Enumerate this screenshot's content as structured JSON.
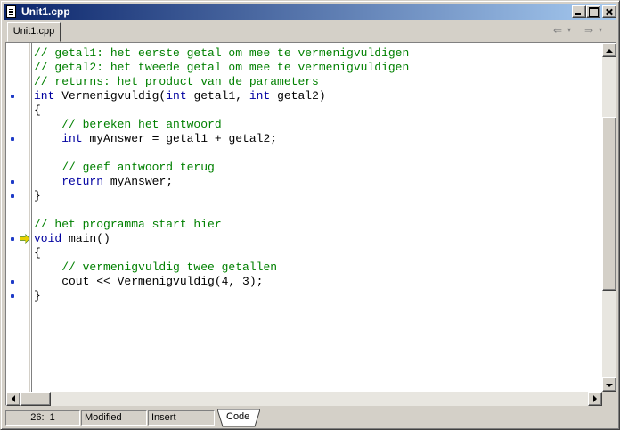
{
  "window": {
    "title": "Unit1.cpp"
  },
  "tabs": [
    {
      "label": "Unit1.cpp"
    }
  ],
  "nav": {
    "back_glyph": "⇐",
    "forward_glyph": "⇒",
    "dropdown_glyph": "▾"
  },
  "editor": {
    "lines": [
      {
        "tokens": [
          {
            "t": "// getal1: het eerste getal om mee te vermenigvuldigen",
            "c": "comment"
          }
        ],
        "marker": false,
        "exec": false
      },
      {
        "tokens": [
          {
            "t": "// getal2: het tweede getal om mee te vermenigvuldigen",
            "c": "comment"
          }
        ],
        "marker": false,
        "exec": false
      },
      {
        "tokens": [
          {
            "t": "// returns: het product van de parameters",
            "c": "comment"
          }
        ],
        "marker": false,
        "exec": false
      },
      {
        "tokens": [
          {
            "t": "int",
            "c": "keyword"
          },
          {
            "t": " Vermenigvuldig(",
            "c": "plain"
          },
          {
            "t": "int",
            "c": "keyword"
          },
          {
            "t": " getal1, ",
            "c": "plain"
          },
          {
            "t": "int",
            "c": "keyword"
          },
          {
            "t": " getal2)",
            "c": "plain"
          }
        ],
        "marker": true,
        "exec": false
      },
      {
        "tokens": [
          {
            "t": "{",
            "c": "plain"
          }
        ],
        "marker": false,
        "exec": false
      },
      {
        "tokens": [
          {
            "t": "    // bereken het antwoord",
            "c": "comment"
          }
        ],
        "marker": false,
        "exec": false
      },
      {
        "tokens": [
          {
            "t": "    ",
            "c": "plain"
          },
          {
            "t": "int",
            "c": "keyword"
          },
          {
            "t": " myAnswer = getal1 + getal2;",
            "c": "plain"
          }
        ],
        "marker": true,
        "exec": false
      },
      {
        "tokens": [
          {
            "t": "",
            "c": "plain"
          }
        ],
        "marker": false,
        "exec": false
      },
      {
        "tokens": [
          {
            "t": "    // geef antwoord terug",
            "c": "comment"
          }
        ],
        "marker": false,
        "exec": false
      },
      {
        "tokens": [
          {
            "t": "    ",
            "c": "plain"
          },
          {
            "t": "return",
            "c": "keyword"
          },
          {
            "t": " myAnswer;",
            "c": "plain"
          }
        ],
        "marker": true,
        "exec": false
      },
      {
        "tokens": [
          {
            "t": "}",
            "c": "plain"
          }
        ],
        "marker": true,
        "exec": false
      },
      {
        "tokens": [
          {
            "t": "",
            "c": "plain"
          }
        ],
        "marker": false,
        "exec": false
      },
      {
        "tokens": [
          {
            "t": "// het programma start hier",
            "c": "comment"
          }
        ],
        "marker": false,
        "exec": false
      },
      {
        "tokens": [
          {
            "t": "void",
            "c": "keyword"
          },
          {
            "t": " main()",
            "c": "plain"
          }
        ],
        "marker": true,
        "exec": true
      },
      {
        "tokens": [
          {
            "t": "{",
            "c": "plain"
          }
        ],
        "marker": false,
        "exec": false
      },
      {
        "tokens": [
          {
            "t": "    // vermenigvuldig twee getallen",
            "c": "comment"
          }
        ],
        "marker": false,
        "exec": false
      },
      {
        "tokens": [
          {
            "t": "    cout << Vermenigvuldig(4, 3);",
            "c": "plain"
          }
        ],
        "marker": true,
        "exec": false
      },
      {
        "tokens": [
          {
            "t": "}",
            "c": "plain"
          }
        ],
        "marker": true,
        "exec": false
      }
    ]
  },
  "colors": {
    "comment": "#008000",
    "keyword": "#0000a0",
    "marker": "#1f3cc8",
    "exec_arrow": "#e8d100"
  },
  "statusbar": {
    "line": "26",
    "col": "1",
    "modified": "Modified",
    "mode": "Insert",
    "view_tab": "Code"
  }
}
